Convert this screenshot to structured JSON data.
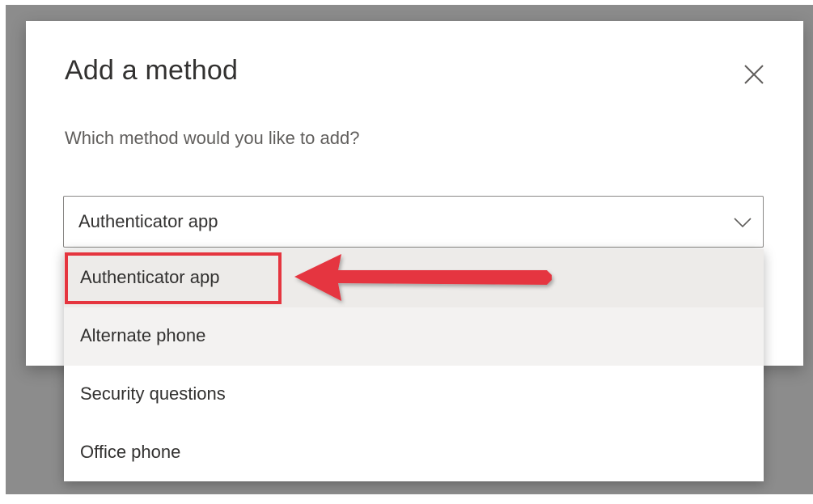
{
  "dialog": {
    "title": "Add a method",
    "question": "Which method would you like to add?",
    "close_icon": "close-icon"
  },
  "select": {
    "value": "Authenticator app",
    "chevron_icon": "chevron-down-icon"
  },
  "dropdown": {
    "options": [
      {
        "label": "Authenticator app",
        "state": "selected"
      },
      {
        "label": "Alternate phone",
        "state": "hover"
      },
      {
        "label": "Security questions",
        "state": "normal"
      },
      {
        "label": "Office phone",
        "state": "normal"
      }
    ]
  },
  "annotation": {
    "color": "#e5353f",
    "arrow_icon": "arrow-left-icon"
  },
  "colors": {
    "overlay": "#8c8c8c",
    "text_primary": "#323130",
    "text_secondary": "#605e5c",
    "selected_option_bg": "#edebe9",
    "hover_option_bg": "#f3f2f1"
  }
}
